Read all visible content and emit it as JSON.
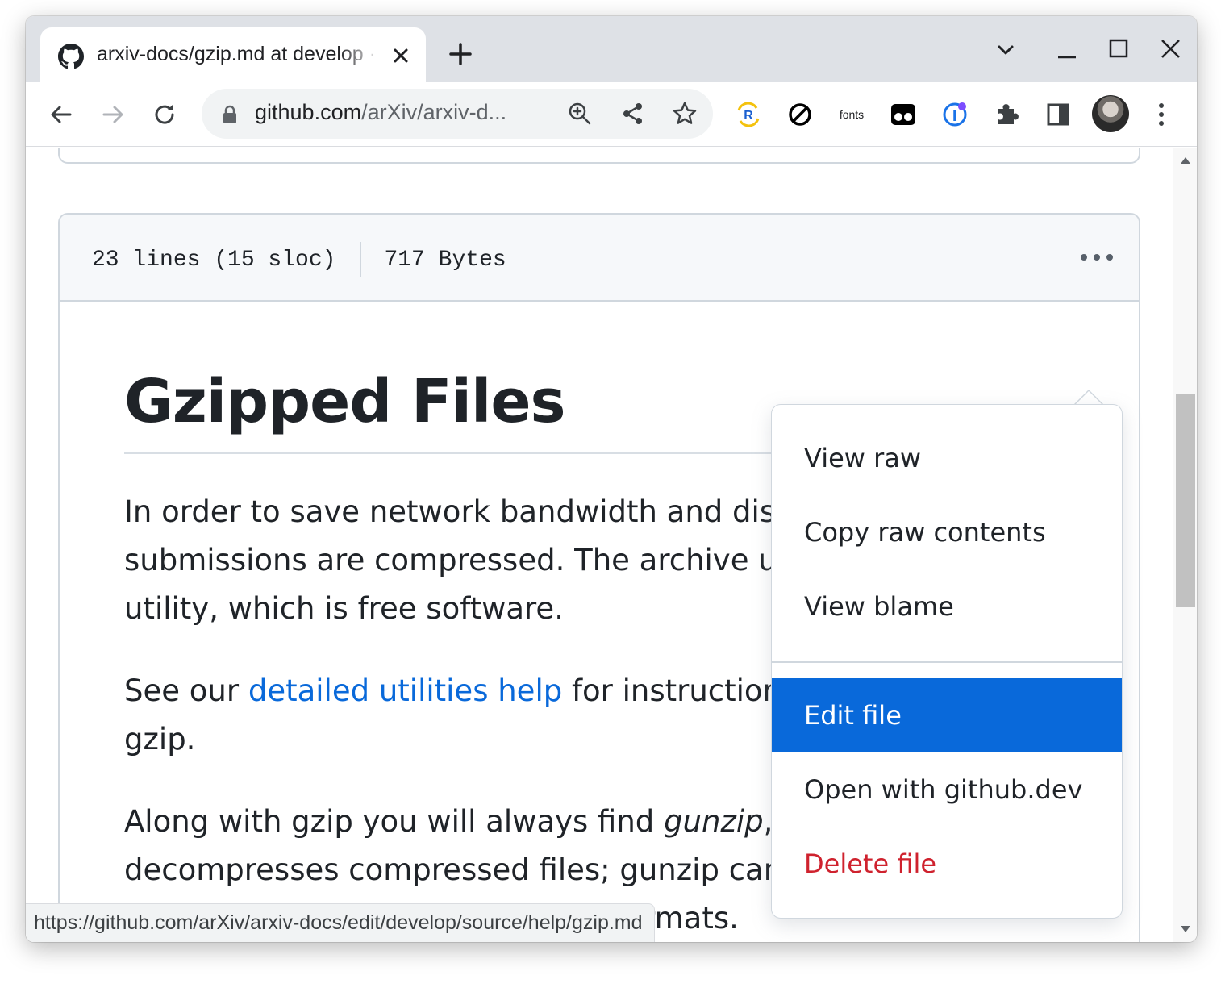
{
  "tab": {
    "title": "arxiv-docs/gzip.md at develop · arXiv/arxiv-docs"
  },
  "omnibox": {
    "host": "github.com",
    "path": "/arXiv/arxiv-d..."
  },
  "extensions": {
    "fonts_label": "fonts"
  },
  "file": {
    "lines": "23 lines (15 sloc)",
    "size": "717 Bytes"
  },
  "markdown": {
    "heading": "Gzipped Files",
    "p1": "In order to save network bandwidth and disk space, all arXiv submissions are compressed. The archive uses the gzip utility, which is free software.",
    "p2_before": "See our ",
    "p2_link": "detailed utilities help",
    "p2_after": " for instructions on how to obtain gzip.",
    "p3_before": "Along with gzip you will always find ",
    "p3_em": "gunzip",
    "p3_after": ", which decompresses compressed files; gunzip can uncompress files in several different compression formats."
  },
  "menu": {
    "items": [
      {
        "label": "View raw"
      },
      {
        "label": "Copy raw contents"
      },
      {
        "label": "View blame"
      },
      {
        "label": "Edit file"
      },
      {
        "label": "Open with github.dev"
      },
      {
        "label": "Delete file"
      }
    ]
  },
  "status_bar": {
    "url": "https://github.com/arXiv/arxiv-docs/edit/develop/source/help/gzip.md"
  },
  "colors": {
    "link": "#0969da",
    "menu_active_bg": "#0969da",
    "danger": "#cf222e"
  }
}
